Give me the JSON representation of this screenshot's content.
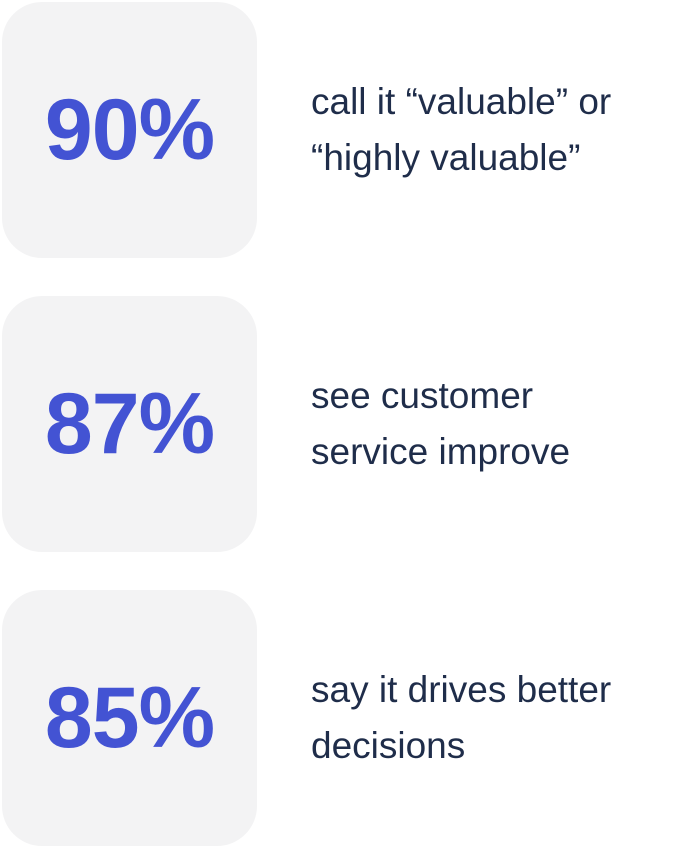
{
  "stats": [
    {
      "value": "90%",
      "caption": "call it “valuable” or\n“highly valuable”"
    },
    {
      "value": "87%",
      "caption": "see customer\nservice improve"
    },
    {
      "value": "85%",
      "caption": "say it drives better\ndecisions"
    }
  ],
  "colors": {
    "accent": "#4353d3",
    "text": "#1f2d4a",
    "box_bg": "#f3f3f4"
  }
}
